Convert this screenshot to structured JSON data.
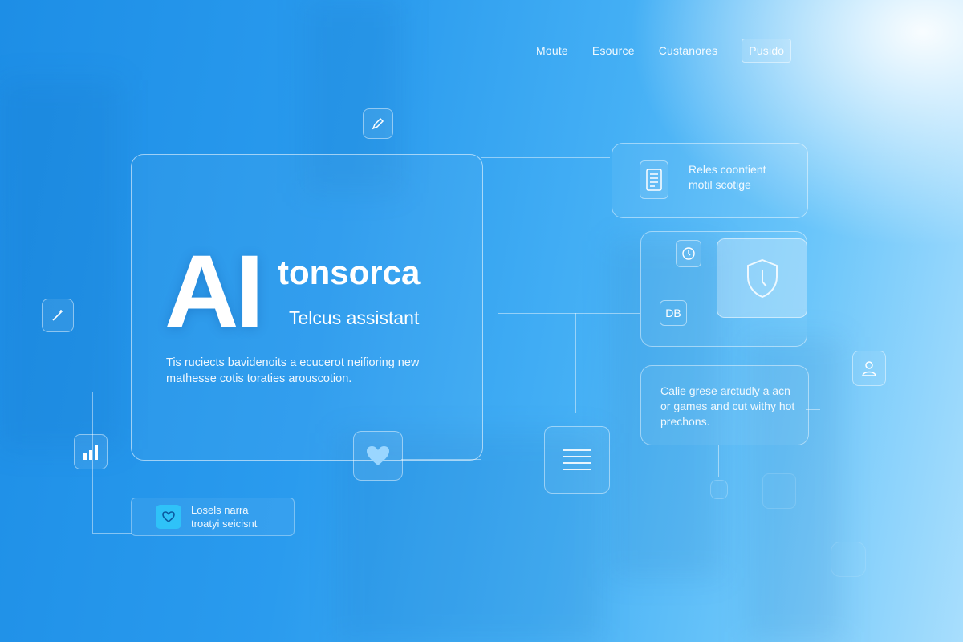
{
  "nav": {
    "items": [
      "Moute",
      "Esource",
      "Custanores"
    ],
    "button_label": "Pusido"
  },
  "hero": {
    "ai_mark": "AI",
    "brand": "tonsorca",
    "subtitle": "Telcus assistant",
    "description": "Tis ruciects bavidenoits a ecucerot neifioring new mathesse cotis toraties arouscotion."
  },
  "cards": {
    "top_right": "Reles coontient\nmotil scotige",
    "db_label": "DB",
    "middle_right": "Calie grese arctudly a acn or games and cut withy hot prechons."
  },
  "mini_card": {
    "text": "Losels narra\ntroatyi seicisnt"
  },
  "icons": {
    "top_float": "pencil-icon",
    "left_float": "wand-icon",
    "chart": "bar-chart-icon",
    "heart": "heart-icon",
    "document": "document-icon",
    "list": "list-icon",
    "user": "user-icon",
    "clock": "clock-icon",
    "shield": "shield-icon",
    "mini": "chat-heart-icon"
  },
  "colors": {
    "accent": "#2fc2f8",
    "background_start": "#1d8ee6",
    "background_end": "#a8defd"
  }
}
